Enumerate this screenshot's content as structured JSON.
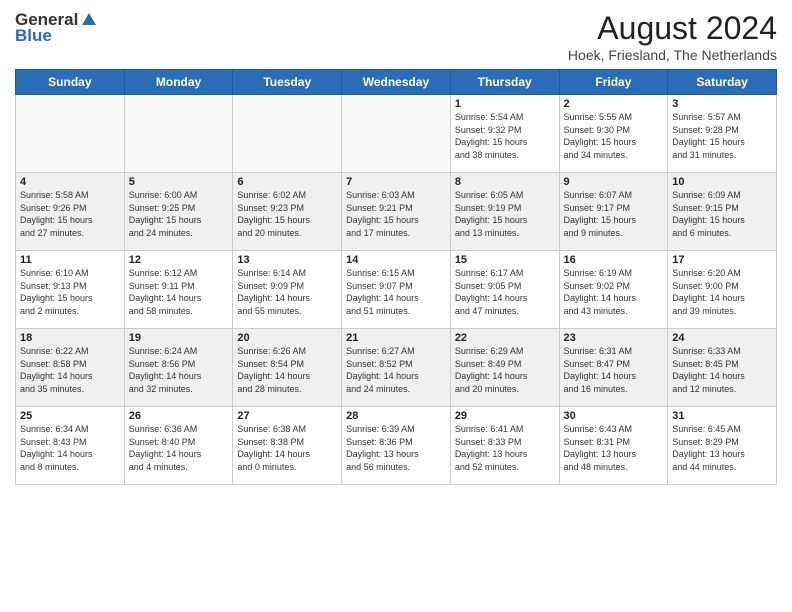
{
  "header": {
    "logo_general": "General",
    "logo_blue": "Blue",
    "month_year": "August 2024",
    "location": "Hoek, Friesland, The Netherlands"
  },
  "weekdays": [
    "Sunday",
    "Monday",
    "Tuesday",
    "Wednesday",
    "Thursday",
    "Friday",
    "Saturday"
  ],
  "weeks": [
    {
      "shaded": false,
      "days": [
        {
          "date": "",
          "info": ""
        },
        {
          "date": "",
          "info": ""
        },
        {
          "date": "",
          "info": ""
        },
        {
          "date": "",
          "info": ""
        },
        {
          "date": "1",
          "info": "Sunrise: 5:54 AM\nSunset: 9:32 PM\nDaylight: 15 hours\nand 38 minutes."
        },
        {
          "date": "2",
          "info": "Sunrise: 5:55 AM\nSunset: 9:30 PM\nDaylight: 15 hours\nand 34 minutes."
        },
        {
          "date": "3",
          "info": "Sunrise: 5:57 AM\nSunset: 9:28 PM\nDaylight: 15 hours\nand 31 minutes."
        }
      ]
    },
    {
      "shaded": true,
      "days": [
        {
          "date": "4",
          "info": "Sunrise: 5:58 AM\nSunset: 9:26 PM\nDaylight: 15 hours\nand 27 minutes."
        },
        {
          "date": "5",
          "info": "Sunrise: 6:00 AM\nSunset: 9:25 PM\nDaylight: 15 hours\nand 24 minutes."
        },
        {
          "date": "6",
          "info": "Sunrise: 6:02 AM\nSunset: 9:23 PM\nDaylight: 15 hours\nand 20 minutes."
        },
        {
          "date": "7",
          "info": "Sunrise: 6:03 AM\nSunset: 9:21 PM\nDaylight: 15 hours\nand 17 minutes."
        },
        {
          "date": "8",
          "info": "Sunrise: 6:05 AM\nSunset: 9:19 PM\nDaylight: 15 hours\nand 13 minutes."
        },
        {
          "date": "9",
          "info": "Sunrise: 6:07 AM\nSunset: 9:17 PM\nDaylight: 15 hours\nand 9 minutes."
        },
        {
          "date": "10",
          "info": "Sunrise: 6:09 AM\nSunset: 9:15 PM\nDaylight: 15 hours\nand 6 minutes."
        }
      ]
    },
    {
      "shaded": false,
      "days": [
        {
          "date": "11",
          "info": "Sunrise: 6:10 AM\nSunset: 9:13 PM\nDaylight: 15 hours\nand 2 minutes."
        },
        {
          "date": "12",
          "info": "Sunrise: 6:12 AM\nSunset: 9:11 PM\nDaylight: 14 hours\nand 58 minutes."
        },
        {
          "date": "13",
          "info": "Sunrise: 6:14 AM\nSunset: 9:09 PM\nDaylight: 14 hours\nand 55 minutes."
        },
        {
          "date": "14",
          "info": "Sunrise: 6:15 AM\nSunset: 9:07 PM\nDaylight: 14 hours\nand 51 minutes."
        },
        {
          "date": "15",
          "info": "Sunrise: 6:17 AM\nSunset: 9:05 PM\nDaylight: 14 hours\nand 47 minutes."
        },
        {
          "date": "16",
          "info": "Sunrise: 6:19 AM\nSunset: 9:02 PM\nDaylight: 14 hours\nand 43 minutes."
        },
        {
          "date": "17",
          "info": "Sunrise: 6:20 AM\nSunset: 9:00 PM\nDaylight: 14 hours\nand 39 minutes."
        }
      ]
    },
    {
      "shaded": true,
      "days": [
        {
          "date": "18",
          "info": "Sunrise: 6:22 AM\nSunset: 8:58 PM\nDaylight: 14 hours\nand 35 minutes."
        },
        {
          "date": "19",
          "info": "Sunrise: 6:24 AM\nSunset: 8:56 PM\nDaylight: 14 hours\nand 32 minutes."
        },
        {
          "date": "20",
          "info": "Sunrise: 6:26 AM\nSunset: 8:54 PM\nDaylight: 14 hours\nand 28 minutes."
        },
        {
          "date": "21",
          "info": "Sunrise: 6:27 AM\nSunset: 8:52 PM\nDaylight: 14 hours\nand 24 minutes."
        },
        {
          "date": "22",
          "info": "Sunrise: 6:29 AM\nSunset: 8:49 PM\nDaylight: 14 hours\nand 20 minutes."
        },
        {
          "date": "23",
          "info": "Sunrise: 6:31 AM\nSunset: 8:47 PM\nDaylight: 14 hours\nand 16 minutes."
        },
        {
          "date": "24",
          "info": "Sunrise: 6:33 AM\nSunset: 8:45 PM\nDaylight: 14 hours\nand 12 minutes."
        }
      ]
    },
    {
      "shaded": false,
      "days": [
        {
          "date": "25",
          "info": "Sunrise: 6:34 AM\nSunset: 8:43 PM\nDaylight: 14 hours\nand 8 minutes."
        },
        {
          "date": "26",
          "info": "Sunrise: 6:36 AM\nSunset: 8:40 PM\nDaylight: 14 hours\nand 4 minutes."
        },
        {
          "date": "27",
          "info": "Sunrise: 6:38 AM\nSunset: 8:38 PM\nDaylight: 14 hours\nand 0 minutes."
        },
        {
          "date": "28",
          "info": "Sunrise: 6:39 AM\nSunset: 8:36 PM\nDaylight: 13 hours\nand 56 minutes."
        },
        {
          "date": "29",
          "info": "Sunrise: 6:41 AM\nSunset: 8:33 PM\nDaylight: 13 hours\nand 52 minutes."
        },
        {
          "date": "30",
          "info": "Sunrise: 6:43 AM\nSunset: 8:31 PM\nDaylight: 13 hours\nand 48 minutes."
        },
        {
          "date": "31",
          "info": "Sunrise: 6:45 AM\nSunset: 8:29 PM\nDaylight: 13 hours\nand 44 minutes."
        }
      ]
    }
  ]
}
